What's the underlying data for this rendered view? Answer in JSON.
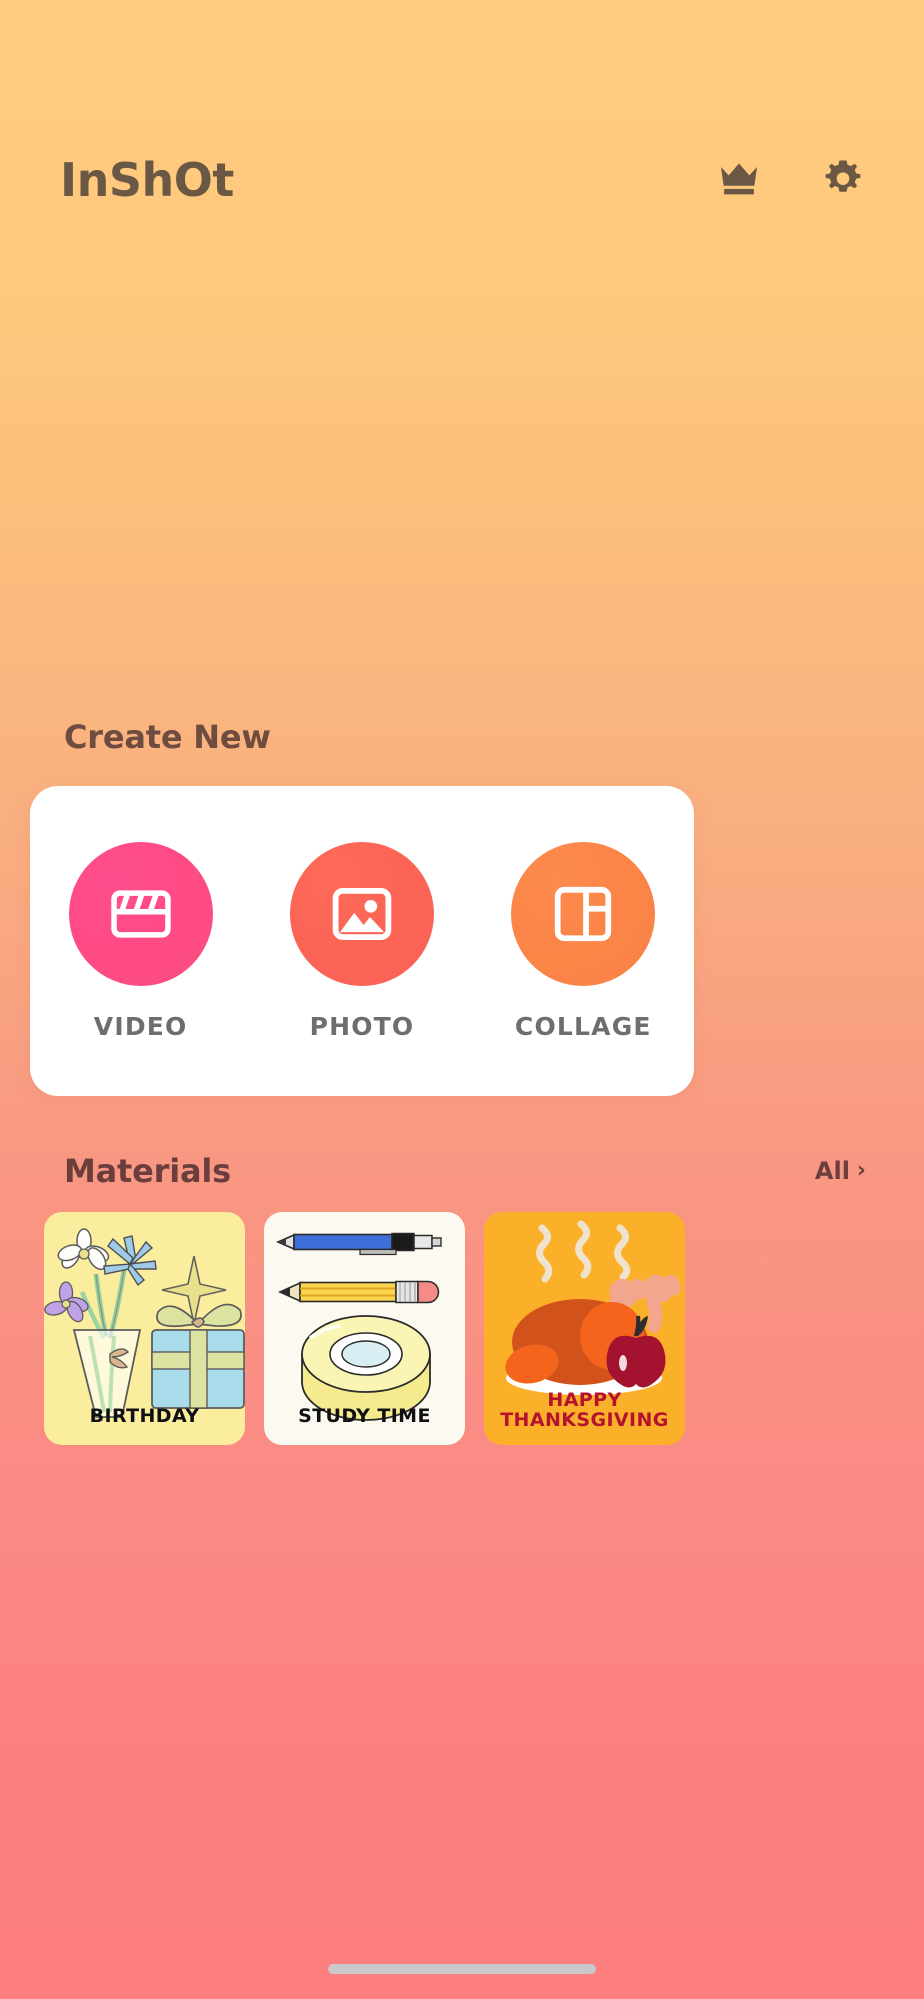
{
  "app": {
    "logo_text": "InShOt"
  },
  "header": {
    "icons": [
      {
        "name": "crown-icon",
        "label": "Pro"
      },
      {
        "name": "gear-icon",
        "label": "Settings"
      }
    ]
  },
  "create_new": {
    "title": "Create New",
    "items": [
      {
        "label": "VIDEO",
        "icon": "clapperboard-icon",
        "color": "#FF4B85"
      },
      {
        "label": "PHOTO",
        "icon": "image-icon",
        "color": "#FB6455"
      },
      {
        "label": "COLLAGE",
        "icon": "collage-grid-icon",
        "color": "#FB8447"
      }
    ]
  },
  "materials": {
    "title": "Materials",
    "all_label": "All",
    "all_chevron": "›",
    "cards": [
      {
        "label": "BIRTHDAY",
        "background": "#FAEE9E",
        "text_color": "#101010"
      },
      {
        "label": "STUDY TIME",
        "background": "#FCFAF0",
        "text_color": "#101010"
      },
      {
        "label": "HAPPY THANKSGIVING",
        "background": "#FBB02A",
        "text_color": "#B4122E"
      }
    ]
  },
  "theme": {
    "gradient_top": "#FFCC80",
    "gradient_bottom": "#FD7F7F",
    "card_background": "#FFFFFF",
    "label_gray": "#6E6E6E"
  }
}
